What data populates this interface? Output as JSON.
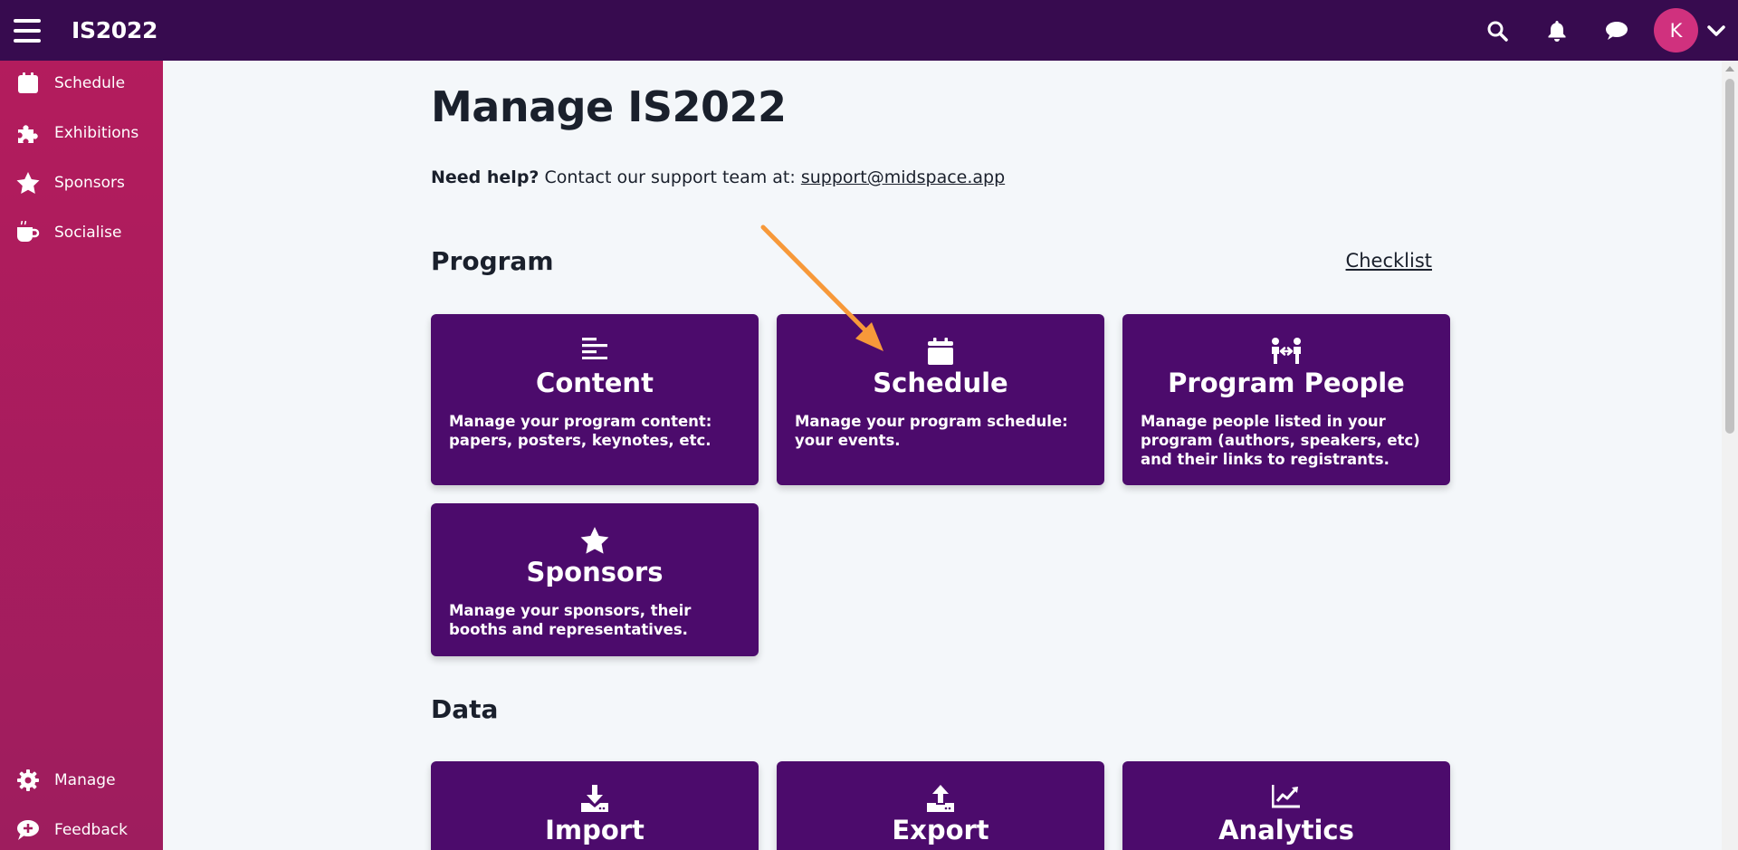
{
  "header": {
    "title": "IS2022",
    "menu_icon": "hamburger-menu-icon",
    "search_icon": "search-icon",
    "notifications_icon": "bell-icon",
    "chat_icon": "chat-bubble-icon",
    "avatar_initial": "K",
    "avatar_color": "#d0317e",
    "dropdown_icon": "chevron-down-icon"
  },
  "sidebar": {
    "items": [
      {
        "label": "Schedule",
        "icon": "calendar-icon"
      },
      {
        "label": "Exhibitions",
        "icon": "puzzle-icon"
      },
      {
        "label": "Sponsors",
        "icon": "star-icon"
      },
      {
        "label": "Socialise",
        "icon": "coffee-icon"
      }
    ],
    "bottom_items": [
      {
        "label": "Manage",
        "icon": "gear-icon"
      },
      {
        "label": "Feedback",
        "icon": "feedback-icon"
      }
    ]
  },
  "main": {
    "title": "Manage IS2022",
    "help_bold": "Need help?",
    "help_text": " Contact our support team at: ",
    "help_email": "support@midspace.app",
    "program": {
      "title": "Program",
      "checklist_label": "Checklist",
      "cards": [
        {
          "title": "Content",
          "icon": "list-lines-icon",
          "description": "Manage your program content: papers, posters, keynotes, etc."
        },
        {
          "title": "Schedule",
          "icon": "calendar-icon",
          "description": "Manage your program schedule: your events."
        },
        {
          "title": "Program People",
          "icon": "people-arrows-icon",
          "description": "Manage people listed in your program (authors, speakers, etc) and their links to registrants."
        },
        {
          "title": "Sponsors",
          "icon": "star-icon",
          "description": "Manage your sponsors, their booths and representatives."
        }
      ]
    },
    "data": {
      "title": "Data",
      "cards": [
        {
          "title": "Import",
          "icon": "download-icon"
        },
        {
          "title": "Export",
          "icon": "upload-icon"
        },
        {
          "title": "Analytics",
          "icon": "chart-line-icon"
        }
      ]
    }
  },
  "colors": {
    "topbar": "#370b4f",
    "sidebar": "#b31c5d",
    "card": "#4c0b6c",
    "arrow": "#f7993a"
  }
}
